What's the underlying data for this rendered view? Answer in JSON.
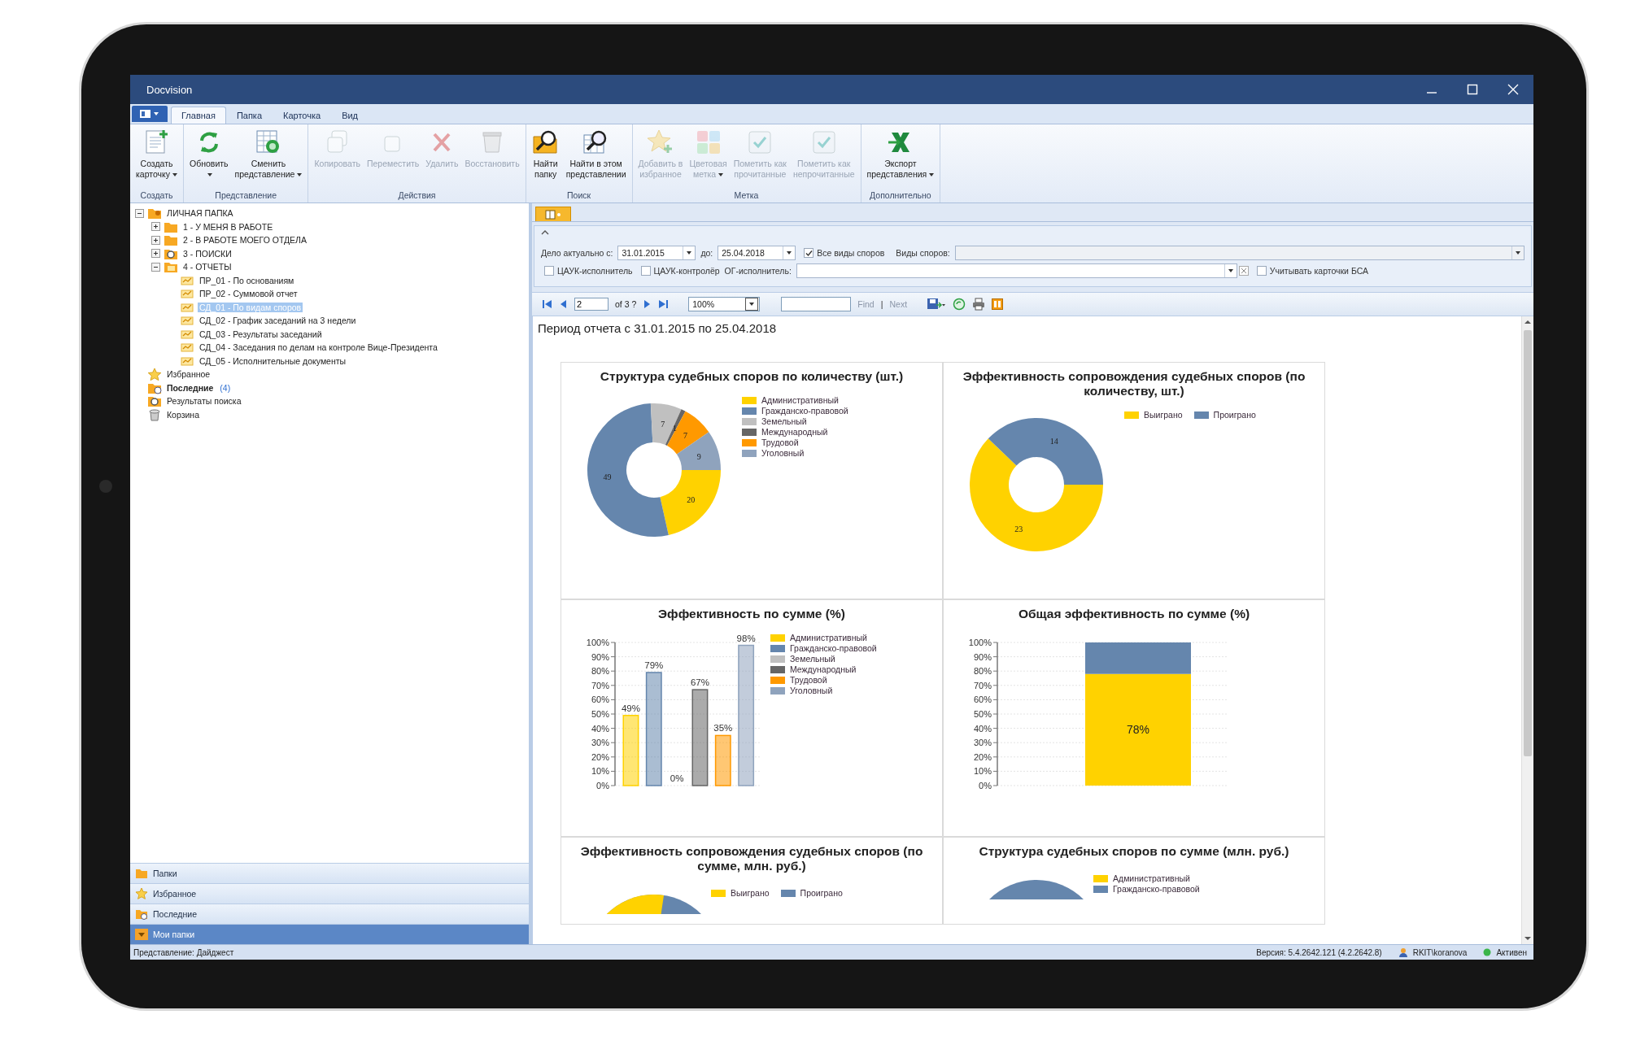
{
  "window": {
    "title": "Docvision"
  },
  "ribbon_tabs": [
    {
      "label": "Главная",
      "selected": true
    },
    {
      "label": "Папка",
      "selected": false
    },
    {
      "label": "Карточка",
      "selected": false
    },
    {
      "label": "Вид",
      "selected": false
    }
  ],
  "ribbon_groups": [
    {
      "label": "Создать",
      "buttons": [
        {
          "lines": [
            "Создать",
            "карточку"
          ],
          "dropdown": true,
          "disabled": false
        }
      ]
    },
    {
      "label": "Представление",
      "buttons": [
        {
          "lines": [
            "Обновить"
          ],
          "dropdown": true,
          "disabled": false
        },
        {
          "lines": [
            "Сменить",
            "представление"
          ],
          "dropdown": true,
          "disabled": false
        }
      ]
    },
    {
      "label": "Действия",
      "buttons": [
        {
          "lines": [
            "Копировать"
          ],
          "dropdown": false,
          "disabled": true
        },
        {
          "lines": [
            "Переместить"
          ],
          "dropdown": false,
          "disabled": true
        },
        {
          "lines": [
            "Удалить"
          ],
          "dropdown": false,
          "disabled": true
        },
        {
          "lines": [
            "Восстановить"
          ],
          "dropdown": false,
          "disabled": true
        }
      ]
    },
    {
      "label": "Поиск",
      "buttons": [
        {
          "lines": [
            "Найти",
            "папку"
          ],
          "dropdown": false,
          "disabled": false
        },
        {
          "lines": [
            "Найти в этом",
            "представлении"
          ],
          "dropdown": false,
          "disabled": false
        }
      ]
    },
    {
      "label": "Метка",
      "buttons": [
        {
          "lines": [
            "Добавить в",
            "избранное"
          ],
          "dropdown": false,
          "disabled": true
        },
        {
          "lines": [
            "Цветовая",
            "метка"
          ],
          "dropdown": true,
          "disabled": true
        },
        {
          "lines": [
            "Пометить как",
            "прочитанные"
          ],
          "dropdown": false,
          "disabled": true
        },
        {
          "lines": [
            "Пометить как",
            "непрочитанные"
          ],
          "dropdown": false,
          "disabled": true
        }
      ]
    },
    {
      "label": "Дополнительно",
      "buttons": [
        {
          "lines": [
            "Экспорт",
            "представления"
          ],
          "dropdown": true,
          "disabled": false
        }
      ]
    }
  ],
  "tree": [
    {
      "label": "ЛИЧНАЯ ПАПКА",
      "kind": "personal",
      "expanded": true,
      "selected": false,
      "children": [
        {
          "label": "1 - У МЕНЯ В РАБОТЕ",
          "kind": "folder",
          "expanded": false,
          "selected": false
        },
        {
          "label": "2 - В РАБОТЕ МОЕГО ОТДЕЛА",
          "kind": "folder",
          "expanded": false,
          "selected": false
        },
        {
          "label": "3 - ПОИСКИ",
          "kind": "search",
          "expanded": false,
          "selected": false
        },
        {
          "label": "4 - ОТЧЕТЫ",
          "kind": "reports",
          "expanded": true,
          "selected": false,
          "children": [
            {
              "label": "ПР_01 - По основаниям",
              "kind": "report",
              "selected": false
            },
            {
              "label": "ПР_02 - Суммовой отчет",
              "kind": "report",
              "selected": false
            },
            {
              "label": "СД_01 - По видам споров",
              "kind": "report",
              "selected": true
            },
            {
              "label": "СД_02 - График заседаний на 3 недели",
              "kind": "report",
              "selected": false
            },
            {
              "label": "СД_03 - Результаты заседаний",
              "kind": "report",
              "selected": false
            },
            {
              "label": "СД_04 - Заседания по делам  на контроле Вице-Президента",
              "kind": "report",
              "selected": false
            },
            {
              "label": "СД_05 - Исполнительные документы",
              "kind": "report",
              "selected": false
            }
          ]
        }
      ]
    },
    {
      "label": "Избранное",
      "kind": "favorites",
      "selected": false
    },
    {
      "label": "Последние",
      "count": "(4)",
      "kind": "recent",
      "selected": false
    },
    {
      "label": "Результаты поиска",
      "kind": "results",
      "selected": false
    },
    {
      "label": "Корзина",
      "kind": "trash",
      "selected": false
    }
  ],
  "nav_panels": [
    {
      "label": "Папки",
      "kind": "folders",
      "selected": false
    },
    {
      "label": "Избранное",
      "kind": "favorites",
      "selected": false
    },
    {
      "label": "Последние",
      "kind": "recent",
      "selected": false
    },
    {
      "label": "Мои папки",
      "kind": "mine",
      "selected": true
    }
  ],
  "filter": {
    "date_from_label": "Дело актуально с:",
    "date_from": "31.01.2015",
    "date_to_label": "до:",
    "date_to": "25.04.2018",
    "all_types": {
      "label": "Все виды споров",
      "checked": true
    },
    "types_label": "Виды споров:",
    "checks": [
      {
        "label": "ЦАУК-исполнитель",
        "checked": false
      },
      {
        "label": "ЦАУК-контролёр",
        "checked": false
      }
    ],
    "og_label": "ОГ-исполнитель:",
    "bsa": {
      "label": "Учитывать карточки БСА",
      "checked": false
    }
  },
  "report_toolbar": {
    "page": "2",
    "page_count": "of 3 ?",
    "zoom": "100%",
    "find_label": "Find",
    "separator": "|",
    "next_label": "Next"
  },
  "report": {
    "period": "Период отчета с 31.01.2015 по 25.04.2018",
    "charts": [
      {
        "chart_data": {
          "type": "donut",
          "title": "Структура судебных споров по количеству (шт.)",
          "data_labels": true,
          "legend": true,
          "categories": [
            "Административный",
            "Гражданско-правовой",
            "Земельный",
            "Международный",
            "Трудовой",
            "Уголовный"
          ],
          "colors": [
            "#ffd200",
            "#6586ad",
            "#c0c0c0",
            "#666666",
            "#ff9900",
            "#8fa3bd"
          ],
          "values": [
            20,
            49,
            7,
            1,
            7,
            9
          ]
        }
      },
      {
        "chart_data": {
          "type": "donut",
          "title": "Эффективность сопровождения судебных споров (по количеству, шт.)",
          "data_labels": true,
          "legend": true,
          "categories": [
            "Выиграно",
            "Проиграно"
          ],
          "colors": [
            "#ffd200",
            "#6586ad"
          ],
          "values": [
            23,
            14
          ]
        }
      },
      {
        "chart_data": {
          "type": "bar",
          "title": "Эффективность по сумме (%)",
          "grid": true,
          "legend": true,
          "ylim": [
            0,
            100
          ],
          "yticks": [
            {
              "value": 0,
              "label": "0%"
            },
            {
              "value": 10,
              "label": "10%"
            },
            {
              "value": 20,
              "label": "20%"
            },
            {
              "value": 30,
              "label": "30%"
            },
            {
              "value": 40,
              "label": "40%"
            },
            {
              "value": 50,
              "label": "50%"
            },
            {
              "value": 60,
              "label": "60%"
            },
            {
              "value": 70,
              "label": "70%"
            },
            {
              "value": 80,
              "label": "80%"
            },
            {
              "value": 90,
              "label": "90%"
            },
            {
              "value": 100,
              "label": "100%"
            }
          ],
          "value_labels": [
            "49%",
            "79%",
            "0%",
            "67%",
            "35%",
            "98%"
          ],
          "series": [
            {
              "name": "Административный",
              "color": "#ffd200",
              "values": [
                49
              ]
            },
            {
              "name": "Гражданско-правовой",
              "color": "#6586ad",
              "values": [
                79
              ]
            },
            {
              "name": "Земельный",
              "color": "#c0c0c0",
              "values": [
                0
              ]
            },
            {
              "name": "Международный",
              "color": "#666666",
              "values": [
                67
              ]
            },
            {
              "name": "Трудовой",
              "color": "#ff9900",
              "values": [
                35
              ]
            },
            {
              "name": "Уголовный",
              "color": "#8fa3bd",
              "values": [
                98
              ]
            }
          ]
        }
      },
      {
        "chart_data": {
          "type": "bar",
          "stacked": true,
          "title": "Общая эффективность по сумме (%)",
          "grid": true,
          "ylim": [
            0,
            100
          ],
          "yticks": [
            {
              "value": 0,
              "label": "0%"
            },
            {
              "value": 10,
              "label": "10%"
            },
            {
              "value": 20,
              "label": "20%"
            },
            {
              "value": 30,
              "label": "30%"
            },
            {
              "value": 40,
              "label": "40%"
            },
            {
              "value": 50,
              "label": "50%"
            },
            {
              "value": 60,
              "label": "60%"
            },
            {
              "value": 70,
              "label": "70%"
            },
            {
              "value": 80,
              "label": "80%"
            },
            {
              "value": 90,
              "label": "90%"
            },
            {
              "value": 100,
              "label": "100%"
            }
          ],
          "value_labels": [
            "78%",
            null
          ],
          "series": [
            {
              "color": "#ffd200",
              "values": [
                78
              ]
            },
            {
              "color": "#6586ad",
              "values": [
                22
              ]
            }
          ]
        }
      }
    ],
    "cut_charts": [
      {
        "title": "Эффективность сопровождения судебных споров (по сумме, млн. руб.)",
        "legend": [
          {
            "name": "Выиграно",
            "color": "#ffd200"
          },
          {
            "name": "Проиграно",
            "color": "#6586ad"
          }
        ]
      },
      {
        "title": "Структура судебных споров по сумме (млн. руб.)",
        "legend": [
          {
            "name": "Административный",
            "color": "#ffd200"
          },
          {
            "name": "Гражданско-правовой",
            "color": "#6586ad"
          }
        ]
      }
    ]
  },
  "status_bar": {
    "view": "Представление: Дайджест",
    "version": "Версия: 5.4.2642.121 (4.2.2642.8)",
    "user": "RKIT\\koranova",
    "state": "Активен"
  }
}
